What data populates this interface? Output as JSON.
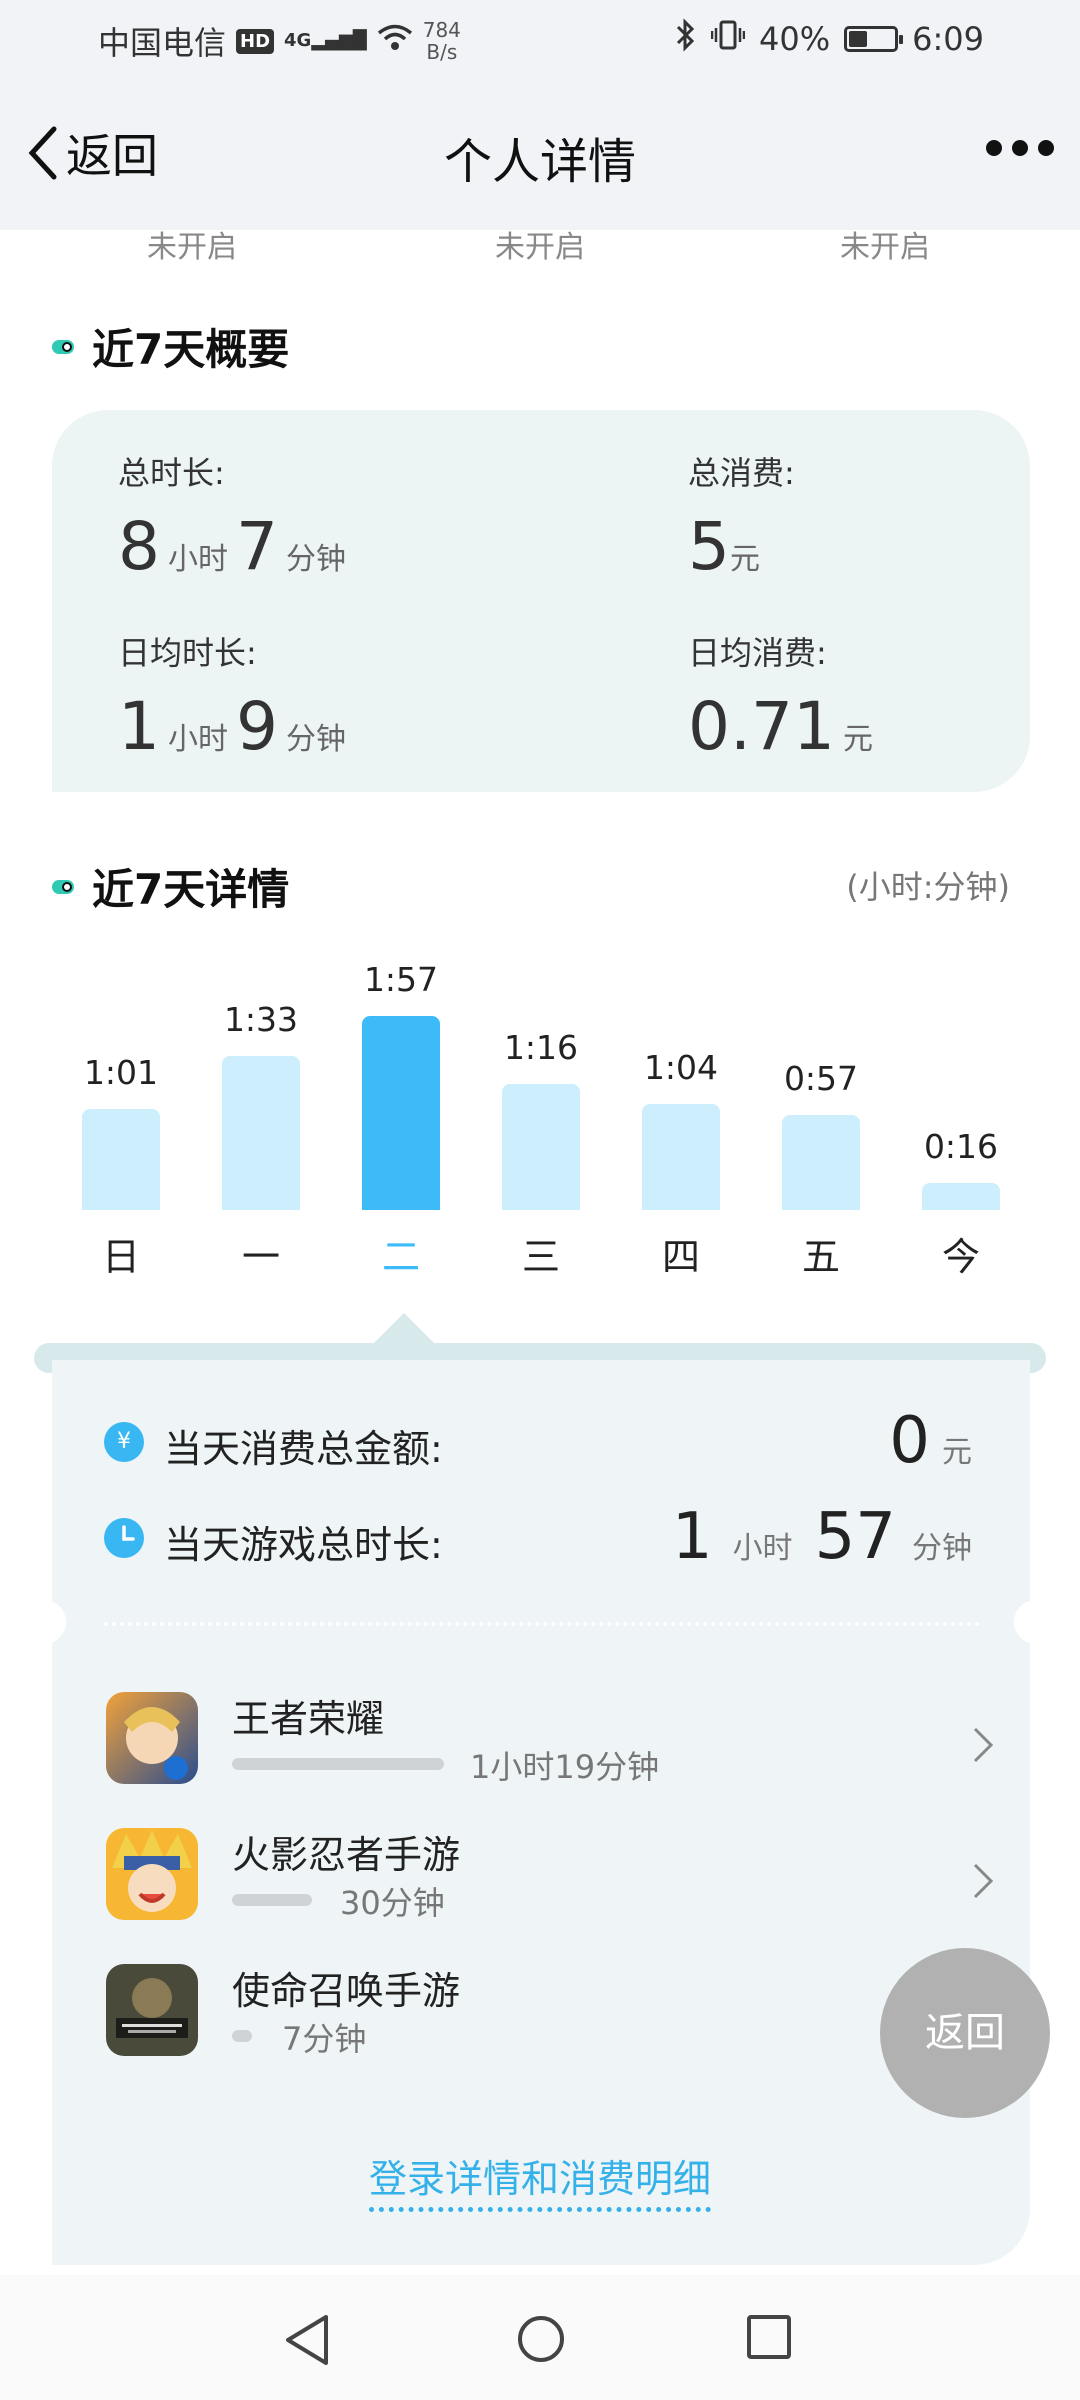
{
  "status_bar": {
    "carrier": "中国电信",
    "hd": "HD",
    "network": "4G",
    "speed_value": "784",
    "speed_unit": "B/s",
    "battery": "40%",
    "battery_level": 0.4,
    "time": "6:09"
  },
  "nav": {
    "back_label": "返回",
    "title": "个人详情",
    "more_icon": "more-dots-icon"
  },
  "status_row": [
    "未开启",
    "未开启",
    "未开启"
  ],
  "summary": {
    "title": "近7天概要",
    "total_duration": {
      "label": "总时长:",
      "hours": "8",
      "hour_unit": "小时",
      "minutes": "7",
      "minute_unit": "分钟"
    },
    "total_spend": {
      "label": "总消费:",
      "amount": "5",
      "unit": "元"
    },
    "avg_duration": {
      "label": "日均时长:",
      "hours": "1",
      "hour_unit": "小时",
      "minutes": "9",
      "minute_unit": "分钟"
    },
    "avg_spend": {
      "label": "日均消费:",
      "amount": "0.71",
      "unit": "元"
    }
  },
  "detail_section": {
    "title": "近7天详情",
    "unit_note": "(小时:分钟)"
  },
  "chart_data": {
    "type": "bar",
    "categories": [
      "日",
      "一",
      "二",
      "三",
      "四",
      "五",
      "今"
    ],
    "labels": [
      "1:01",
      "1:33",
      "1:57",
      "1:16",
      "1:04",
      "0:57",
      "0:16"
    ],
    "values_minutes": [
      61,
      93,
      117,
      76,
      64,
      57,
      16
    ],
    "selected_index": 2,
    "colors": {
      "bar": "#cdeefc",
      "selected": "#3dbbf8"
    }
  },
  "day_detail": {
    "spend_label": "当天消费总金额:",
    "spend_value": "0",
    "spend_unit": "元",
    "time_label": "当天游戏总时长:",
    "time_hours": "1",
    "hour_unit": "小时",
    "time_minutes": "57",
    "minute_unit": "分钟"
  },
  "games": [
    {
      "name": "王者荣耀",
      "time": "1小时19分钟",
      "minutes": 79
    },
    {
      "name": "火影忍者手游",
      "time": "30分钟",
      "minutes": 30
    },
    {
      "name": "使命召唤手游",
      "time": "7分钟",
      "minutes": 7
    }
  ],
  "float_button": "返回",
  "detail_link": "登录详情和消费明细",
  "accent_color": "#35b1e9"
}
